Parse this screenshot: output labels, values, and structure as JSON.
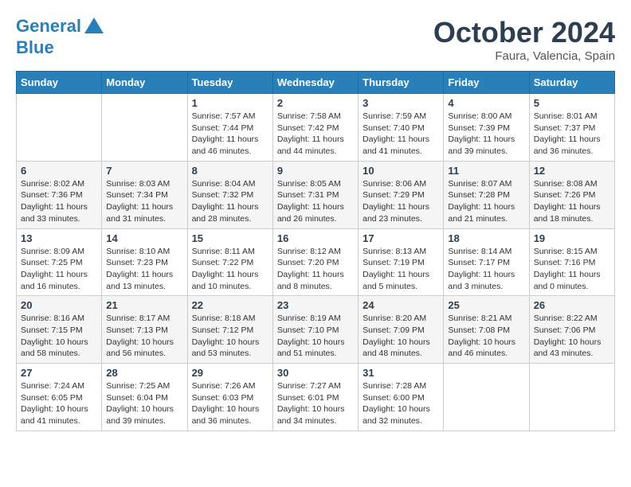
{
  "header": {
    "logo_line1": "General",
    "logo_line2": "Blue",
    "month": "October 2024",
    "location": "Faura, Valencia, Spain"
  },
  "weekdays": [
    "Sunday",
    "Monday",
    "Tuesday",
    "Wednesday",
    "Thursday",
    "Friday",
    "Saturday"
  ],
  "weeks": [
    [
      {
        "day": "",
        "sunrise": "",
        "sunset": "",
        "daylight": ""
      },
      {
        "day": "",
        "sunrise": "",
        "sunset": "",
        "daylight": ""
      },
      {
        "day": "1",
        "sunrise": "Sunrise: 7:57 AM",
        "sunset": "Sunset: 7:44 PM",
        "daylight": "Daylight: 11 hours and 46 minutes."
      },
      {
        "day": "2",
        "sunrise": "Sunrise: 7:58 AM",
        "sunset": "Sunset: 7:42 PM",
        "daylight": "Daylight: 11 hours and 44 minutes."
      },
      {
        "day": "3",
        "sunrise": "Sunrise: 7:59 AM",
        "sunset": "Sunset: 7:40 PM",
        "daylight": "Daylight: 11 hours and 41 minutes."
      },
      {
        "day": "4",
        "sunrise": "Sunrise: 8:00 AM",
        "sunset": "Sunset: 7:39 PM",
        "daylight": "Daylight: 11 hours and 39 minutes."
      },
      {
        "day": "5",
        "sunrise": "Sunrise: 8:01 AM",
        "sunset": "Sunset: 7:37 PM",
        "daylight": "Daylight: 11 hours and 36 minutes."
      }
    ],
    [
      {
        "day": "6",
        "sunrise": "Sunrise: 8:02 AM",
        "sunset": "Sunset: 7:36 PM",
        "daylight": "Daylight: 11 hours and 33 minutes."
      },
      {
        "day": "7",
        "sunrise": "Sunrise: 8:03 AM",
        "sunset": "Sunset: 7:34 PM",
        "daylight": "Daylight: 11 hours and 31 minutes."
      },
      {
        "day": "8",
        "sunrise": "Sunrise: 8:04 AM",
        "sunset": "Sunset: 7:32 PM",
        "daylight": "Daylight: 11 hours and 28 minutes."
      },
      {
        "day": "9",
        "sunrise": "Sunrise: 8:05 AM",
        "sunset": "Sunset: 7:31 PM",
        "daylight": "Daylight: 11 hours and 26 minutes."
      },
      {
        "day": "10",
        "sunrise": "Sunrise: 8:06 AM",
        "sunset": "Sunset: 7:29 PM",
        "daylight": "Daylight: 11 hours and 23 minutes."
      },
      {
        "day": "11",
        "sunrise": "Sunrise: 8:07 AM",
        "sunset": "Sunset: 7:28 PM",
        "daylight": "Daylight: 11 hours and 21 minutes."
      },
      {
        "day": "12",
        "sunrise": "Sunrise: 8:08 AM",
        "sunset": "Sunset: 7:26 PM",
        "daylight": "Daylight: 11 hours and 18 minutes."
      }
    ],
    [
      {
        "day": "13",
        "sunrise": "Sunrise: 8:09 AM",
        "sunset": "Sunset: 7:25 PM",
        "daylight": "Daylight: 11 hours and 16 minutes."
      },
      {
        "day": "14",
        "sunrise": "Sunrise: 8:10 AM",
        "sunset": "Sunset: 7:23 PM",
        "daylight": "Daylight: 11 hours and 13 minutes."
      },
      {
        "day": "15",
        "sunrise": "Sunrise: 8:11 AM",
        "sunset": "Sunset: 7:22 PM",
        "daylight": "Daylight: 11 hours and 10 minutes."
      },
      {
        "day": "16",
        "sunrise": "Sunrise: 8:12 AM",
        "sunset": "Sunset: 7:20 PM",
        "daylight": "Daylight: 11 hours and 8 minutes."
      },
      {
        "day": "17",
        "sunrise": "Sunrise: 8:13 AM",
        "sunset": "Sunset: 7:19 PM",
        "daylight": "Daylight: 11 hours and 5 minutes."
      },
      {
        "day": "18",
        "sunrise": "Sunrise: 8:14 AM",
        "sunset": "Sunset: 7:17 PM",
        "daylight": "Daylight: 11 hours and 3 minutes."
      },
      {
        "day": "19",
        "sunrise": "Sunrise: 8:15 AM",
        "sunset": "Sunset: 7:16 PM",
        "daylight": "Daylight: 11 hours and 0 minutes."
      }
    ],
    [
      {
        "day": "20",
        "sunrise": "Sunrise: 8:16 AM",
        "sunset": "Sunset: 7:15 PM",
        "daylight": "Daylight: 10 hours and 58 minutes."
      },
      {
        "day": "21",
        "sunrise": "Sunrise: 8:17 AM",
        "sunset": "Sunset: 7:13 PM",
        "daylight": "Daylight: 10 hours and 56 minutes."
      },
      {
        "day": "22",
        "sunrise": "Sunrise: 8:18 AM",
        "sunset": "Sunset: 7:12 PM",
        "daylight": "Daylight: 10 hours and 53 minutes."
      },
      {
        "day": "23",
        "sunrise": "Sunrise: 8:19 AM",
        "sunset": "Sunset: 7:10 PM",
        "daylight": "Daylight: 10 hours and 51 minutes."
      },
      {
        "day": "24",
        "sunrise": "Sunrise: 8:20 AM",
        "sunset": "Sunset: 7:09 PM",
        "daylight": "Daylight: 10 hours and 48 minutes."
      },
      {
        "day": "25",
        "sunrise": "Sunrise: 8:21 AM",
        "sunset": "Sunset: 7:08 PM",
        "daylight": "Daylight: 10 hours and 46 minutes."
      },
      {
        "day": "26",
        "sunrise": "Sunrise: 8:22 AM",
        "sunset": "Sunset: 7:06 PM",
        "daylight": "Daylight: 10 hours and 43 minutes."
      }
    ],
    [
      {
        "day": "27",
        "sunrise": "Sunrise: 7:24 AM",
        "sunset": "Sunset: 6:05 PM",
        "daylight": "Daylight: 10 hours and 41 minutes."
      },
      {
        "day": "28",
        "sunrise": "Sunrise: 7:25 AM",
        "sunset": "Sunset: 6:04 PM",
        "daylight": "Daylight: 10 hours and 39 minutes."
      },
      {
        "day": "29",
        "sunrise": "Sunrise: 7:26 AM",
        "sunset": "Sunset: 6:03 PM",
        "daylight": "Daylight: 10 hours and 36 minutes."
      },
      {
        "day": "30",
        "sunrise": "Sunrise: 7:27 AM",
        "sunset": "Sunset: 6:01 PM",
        "daylight": "Daylight: 10 hours and 34 minutes."
      },
      {
        "day": "31",
        "sunrise": "Sunrise: 7:28 AM",
        "sunset": "Sunset: 6:00 PM",
        "daylight": "Daylight: 10 hours and 32 minutes."
      },
      {
        "day": "",
        "sunrise": "",
        "sunset": "",
        "daylight": ""
      },
      {
        "day": "",
        "sunrise": "",
        "sunset": "",
        "daylight": ""
      }
    ]
  ]
}
